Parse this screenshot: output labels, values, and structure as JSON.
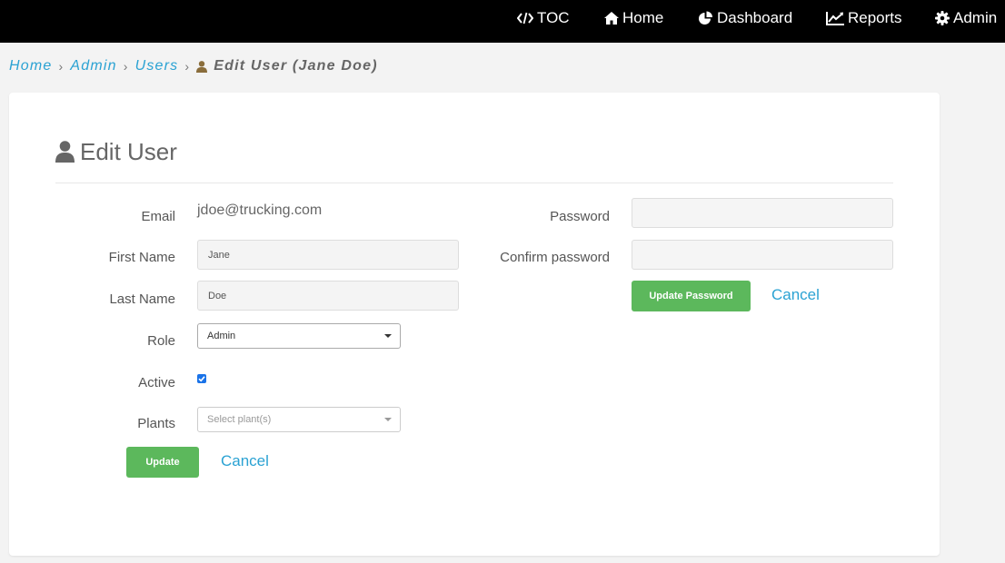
{
  "nav": {
    "items": [
      {
        "label": "TOC",
        "icon": "code-icon"
      },
      {
        "label": "Home",
        "icon": "home-icon"
      },
      {
        "label": "Dashboard",
        "icon": "pie-chart-icon"
      },
      {
        "label": "Reports",
        "icon": "line-chart-icon"
      },
      {
        "label": "Admin",
        "icon": "gear-icon"
      }
    ]
  },
  "breadcrumb": {
    "items": [
      "Home",
      "Admin",
      "Users"
    ],
    "current": "Edit User (Jane Doe)"
  },
  "form": {
    "title": "Edit User",
    "email_label": "Email",
    "email_value": "jdoe@trucking.com",
    "first_name_label": "First Name",
    "first_name_value": "Jane",
    "last_name_label": "Last Name",
    "last_name_value": "Doe",
    "role_label": "Role",
    "role_value": "Admin",
    "active_label": "Active",
    "active_checked": true,
    "plants_label": "Plants",
    "plants_placeholder": "Select plant(s)",
    "update_label": "Update",
    "cancel_label": "Cancel",
    "password_label": "Password",
    "password_value": "",
    "confirm_password_label": "Confirm password",
    "confirm_password_value": "",
    "update_password_label": "Update Password",
    "cancel_password_label": "Cancel"
  },
  "colors": {
    "nav_bg": "#000000",
    "link": "#2aa2d3",
    "button_green": "#5cb85c",
    "checkbox_blue": "#1a73e8",
    "breadcrumb_icon": "#8a6d3b"
  }
}
